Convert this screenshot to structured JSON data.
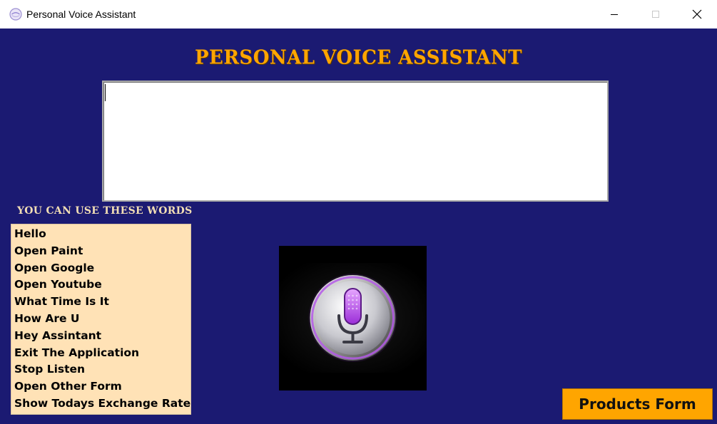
{
  "window": {
    "title": "Personal Voice Assistant"
  },
  "header": {
    "title": "PERSONAL VOICE ASSISTANT"
  },
  "transcript": {
    "value": ""
  },
  "commands": {
    "label": "YOU CAN USE THESE WORDS",
    "items": [
      "Hello",
      "Open Paint",
      "Open Google",
      "Open Youtube",
      "What Time Is It",
      "How Are U",
      "Hey Assintant",
      "Exit The Application",
      "Stop Listen",
      "Open Other Form",
      "Show Todays Exchange Rate"
    ]
  },
  "mic": {
    "icon": "microphone-icon"
  },
  "actions": {
    "products_form": "Products Form"
  },
  "colors": {
    "background": "#1b1a72",
    "accent": "#ffa500",
    "list_background": "#ffe2b6",
    "label": "#f2deb5"
  }
}
